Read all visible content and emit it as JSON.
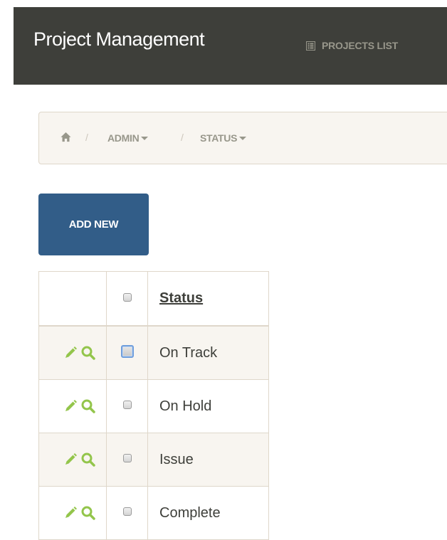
{
  "navbar": {
    "brand": "Project Management",
    "links": [
      {
        "label": "PROJECTS LIST",
        "icon": "list-icon"
      }
    ]
  },
  "breadcrumb": {
    "home_icon": "home-icon",
    "items": [
      {
        "label": "ADMIN"
      },
      {
        "label": "STATUS"
      }
    ]
  },
  "toolbar": {
    "add_new_label": "ADD NEW"
  },
  "table": {
    "columns": [
      "",
      "",
      "Status"
    ],
    "rows": [
      {
        "status": "On Track",
        "focused": true
      },
      {
        "status": "On Hold",
        "focused": false
      },
      {
        "status": "Issue",
        "focused": false
      },
      {
        "status": "Complete",
        "focused": false
      }
    ]
  },
  "colors": {
    "navbar_bg": "#3e3f3a",
    "primary": "#325d88",
    "action_icon": "#93c54b",
    "breadcrumb_bg": "#f8f5f0"
  }
}
